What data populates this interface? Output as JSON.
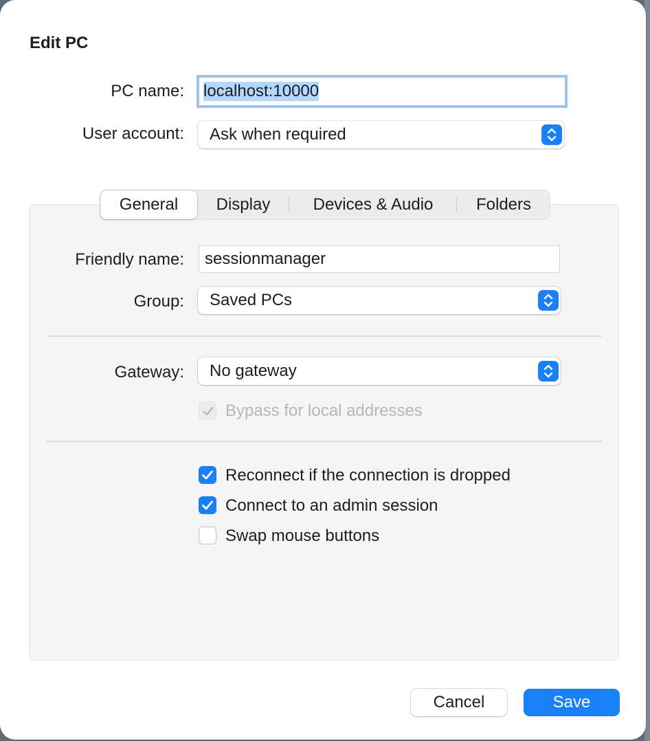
{
  "dialog": {
    "title": "Edit PC"
  },
  "pc_name": {
    "label": "PC name:",
    "value": "localhost:10000"
  },
  "user_account": {
    "label": "User account:",
    "selected": "Ask when required"
  },
  "tabs": [
    {
      "label": "General",
      "active": true
    },
    {
      "label": "Display",
      "active": false
    },
    {
      "label": "Devices & Audio",
      "active": false
    },
    {
      "label": "Folders",
      "active": false
    }
  ],
  "general": {
    "friendly_name": {
      "label": "Friendly name:",
      "value": "sessionmanager"
    },
    "group": {
      "label": "Group:",
      "selected": "Saved PCs"
    },
    "gateway": {
      "label": "Gateway:",
      "selected": "No gateway"
    },
    "bypass_local": {
      "label": "Bypass for local addresses",
      "checked": true,
      "enabled": false
    },
    "reconnect": {
      "label": "Reconnect if the connection is dropped",
      "checked": true
    },
    "admin_session": {
      "label": "Connect to an admin session",
      "checked": true
    },
    "swap_mouse": {
      "label": "Swap mouse buttons",
      "checked": false
    }
  },
  "buttons": {
    "cancel": "Cancel",
    "save": "Save"
  },
  "colors": {
    "accent": "#1a80f7",
    "focus_ring": "#9fc3ef",
    "pane_bg": "#f5f5f5"
  },
  "icons": {
    "popup": "up-down-chevron-icon",
    "check": "checkmark-icon"
  }
}
